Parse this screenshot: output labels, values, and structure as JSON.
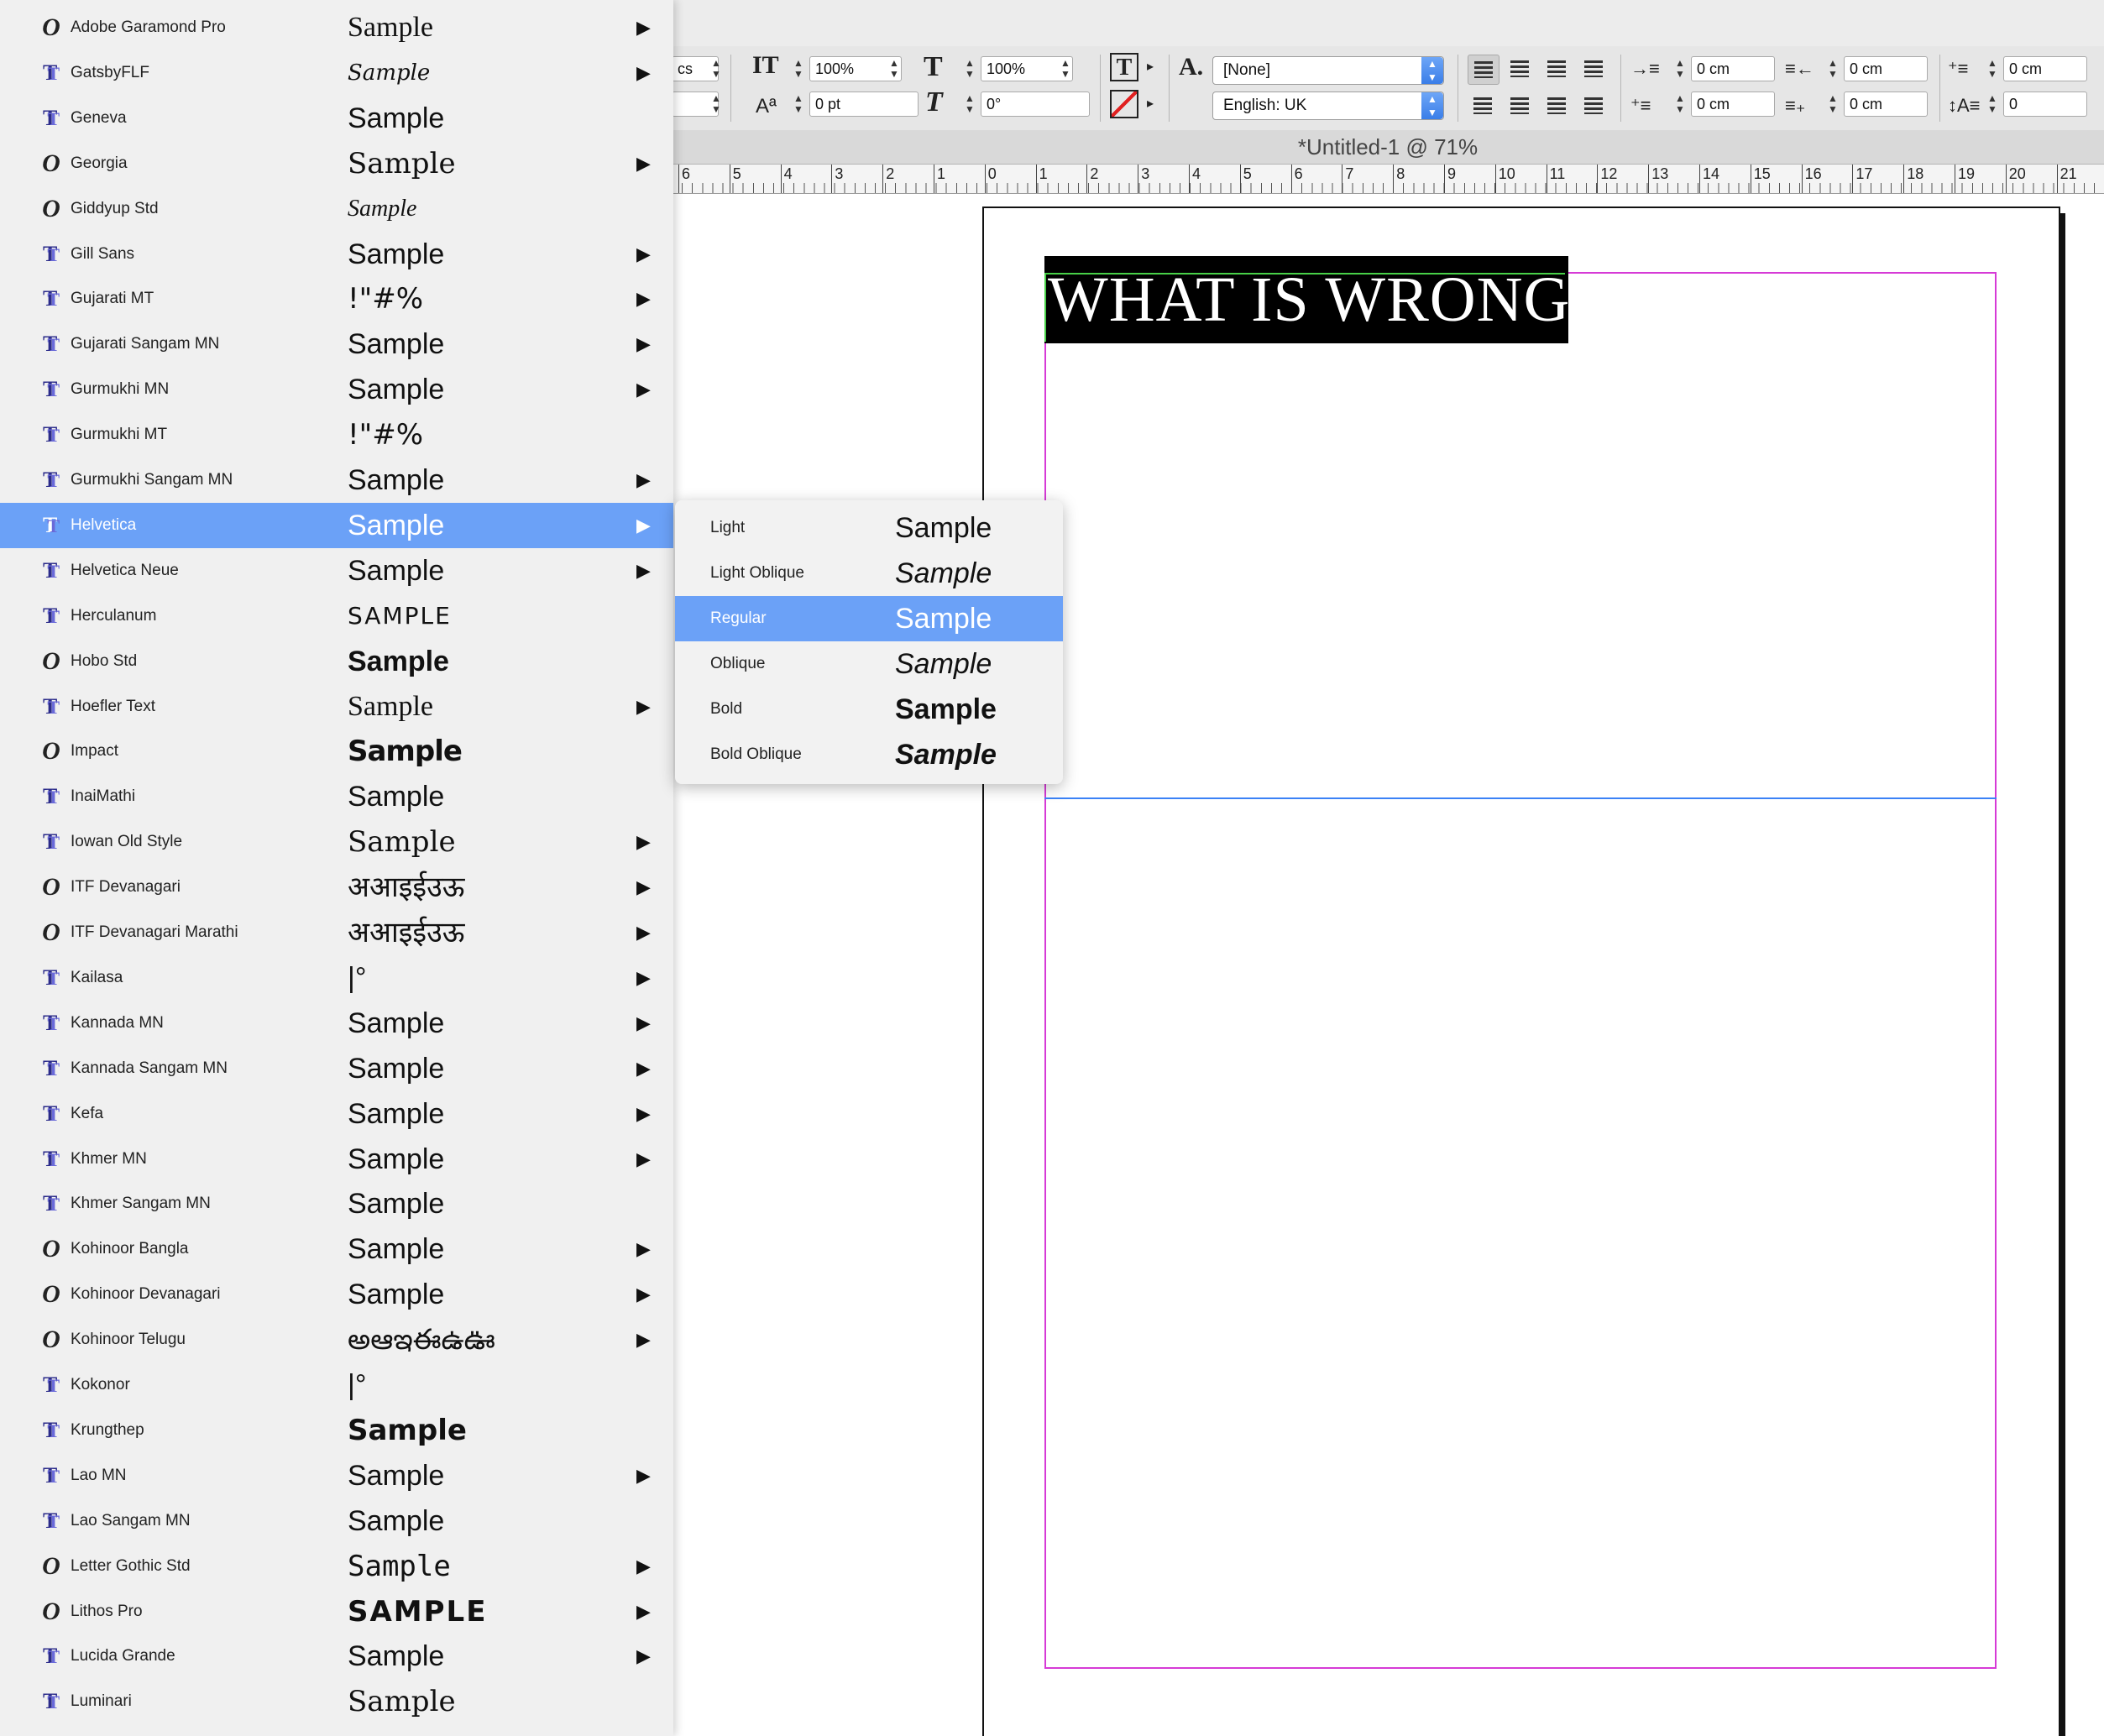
{
  "document": {
    "tab_title": "*Untitled-1 @ 71%",
    "headline": "WHAT IS WRONG"
  },
  "control_panel": {
    "left_field_fragment": "cs",
    "vertical_scale": "100%",
    "horizontal_scale": "100%",
    "baseline_shift": "0 pt",
    "skew": "0°",
    "char_style": "[None]",
    "language": "English: UK",
    "left_indent": "0 cm",
    "right_indent": "0 cm",
    "first_line_indent": "0 cm",
    "last_line_indent": "0 cm",
    "space_before": "0 cm",
    "drop_cap_lines": "0"
  },
  "ruler": {
    "labels": [
      "6",
      "5",
      "4",
      "3",
      "2",
      "1",
      "0",
      "1",
      "2",
      "3",
      "4",
      "5",
      "6",
      "7",
      "8",
      "9",
      "10",
      "11",
      "12",
      "13",
      "14",
      "15",
      "16",
      "17",
      "18",
      "19",
      "20",
      "21"
    ]
  },
  "font_menu": {
    "items": [
      {
        "name": "Adobe Garamond Pro",
        "sample": "Sample",
        "type": "ot",
        "submenu": true
      },
      {
        "name": "GatsbyFLF",
        "sample": "Sample",
        "type": "tt",
        "submenu": true
      },
      {
        "name": "Geneva",
        "sample": "Sample",
        "type": "tt",
        "submenu": false
      },
      {
        "name": "Georgia",
        "sample": "Sample",
        "type": "ot",
        "submenu": true
      },
      {
        "name": "Giddyup Std",
        "sample": "Sample",
        "type": "ot",
        "submenu": false
      },
      {
        "name": "Gill Sans",
        "sample": "Sample",
        "type": "tt",
        "submenu": true
      },
      {
        "name": "Gujarati MT",
        "sample": "!\"#%",
        "type": "tt",
        "submenu": true
      },
      {
        "name": "Gujarati Sangam MN",
        "sample": "Sample",
        "type": "tt",
        "submenu": true
      },
      {
        "name": "Gurmukhi MN",
        "sample": "Sample",
        "type": "tt",
        "submenu": true
      },
      {
        "name": "Gurmukhi MT",
        "sample": "!\"#%",
        "type": "tt",
        "submenu": false
      },
      {
        "name": "Gurmukhi Sangam MN",
        "sample": "Sample",
        "type": "tt",
        "submenu": true
      },
      {
        "name": "Helvetica",
        "sample": "Sample",
        "type": "tt",
        "submenu": true,
        "selected": true
      },
      {
        "name": "Helvetica Neue",
        "sample": "Sample",
        "type": "tt",
        "submenu": true
      },
      {
        "name": "Herculanum",
        "sample": "SAMPLE",
        "type": "tt",
        "submenu": false
      },
      {
        "name": "Hobo Std",
        "sample": "Sample",
        "type": "ot",
        "submenu": false
      },
      {
        "name": "Hoefler Text",
        "sample": "Sample",
        "type": "tt",
        "submenu": true
      },
      {
        "name": "Impact",
        "sample": "Sample",
        "type": "ot",
        "submenu": false
      },
      {
        "name": "InaiMathi",
        "sample": "Sample",
        "type": "tt",
        "submenu": false
      },
      {
        "name": "Iowan Old Style",
        "sample": "Sample",
        "type": "tt",
        "submenu": true
      },
      {
        "name": "ITF Devanagari",
        "sample": "अआइईउऊ",
        "type": "ot",
        "submenu": true
      },
      {
        "name": "ITF Devanagari Marathi",
        "sample": "अआइईउऊ",
        "type": "ot",
        "submenu": true
      },
      {
        "name": "Kailasa",
        "sample": "|°",
        "type": "tt",
        "submenu": true
      },
      {
        "name": "Kannada MN",
        "sample": "Sample",
        "type": "tt",
        "submenu": true
      },
      {
        "name": "Kannada Sangam MN",
        "sample": "Sample",
        "type": "tt",
        "submenu": true
      },
      {
        "name": "Kefa",
        "sample": "Sample",
        "type": "tt",
        "submenu": true
      },
      {
        "name": "Khmer MN",
        "sample": "Sample",
        "type": "tt",
        "submenu": true
      },
      {
        "name": "Khmer Sangam MN",
        "sample": "Sample",
        "type": "tt",
        "submenu": false
      },
      {
        "name": "Kohinoor Bangla",
        "sample": "Sample",
        "type": "ot",
        "submenu": true
      },
      {
        "name": "Kohinoor Devanagari",
        "sample": "Sample",
        "type": "ot",
        "submenu": true
      },
      {
        "name": "Kohinoor Telugu",
        "sample": "అఆఇఈఉఊ",
        "type": "ot",
        "submenu": true
      },
      {
        "name": "Kokonor",
        "sample": "|°",
        "type": "tt",
        "submenu": false
      },
      {
        "name": "Krungthep",
        "sample": "Sample",
        "type": "tt",
        "submenu": false
      },
      {
        "name": "Lao MN",
        "sample": "Sample",
        "type": "tt",
        "submenu": true
      },
      {
        "name": "Lao Sangam MN",
        "sample": "Sample",
        "type": "tt",
        "submenu": false
      },
      {
        "name": "Letter Gothic Std",
        "sample": "Sample",
        "type": "ot",
        "submenu": true
      },
      {
        "name": "Lithos Pro",
        "sample": "SAMPLE",
        "type": "ot",
        "submenu": true
      },
      {
        "name": "Lucida Grande",
        "sample": "Sample",
        "type": "tt",
        "submenu": true
      },
      {
        "name": "Luminari",
        "sample": "Sample",
        "type": "tt",
        "submenu": false
      }
    ]
  },
  "style_submenu": {
    "items": [
      {
        "name": "Light",
        "sample": "Sample"
      },
      {
        "name": "Light Oblique",
        "sample": "Sample"
      },
      {
        "name": "Regular",
        "sample": "Sample",
        "selected": true
      },
      {
        "name": "Oblique",
        "sample": "Sample"
      },
      {
        "name": "Bold",
        "sample": "Sample"
      },
      {
        "name": "Bold Oblique",
        "sample": "Sample"
      }
    ]
  },
  "colors": {
    "selection": "#6ba1f7",
    "margin_guide": "#d63ad6",
    "column_guide": "#3b82f6",
    "text_frame": "#48d048"
  }
}
